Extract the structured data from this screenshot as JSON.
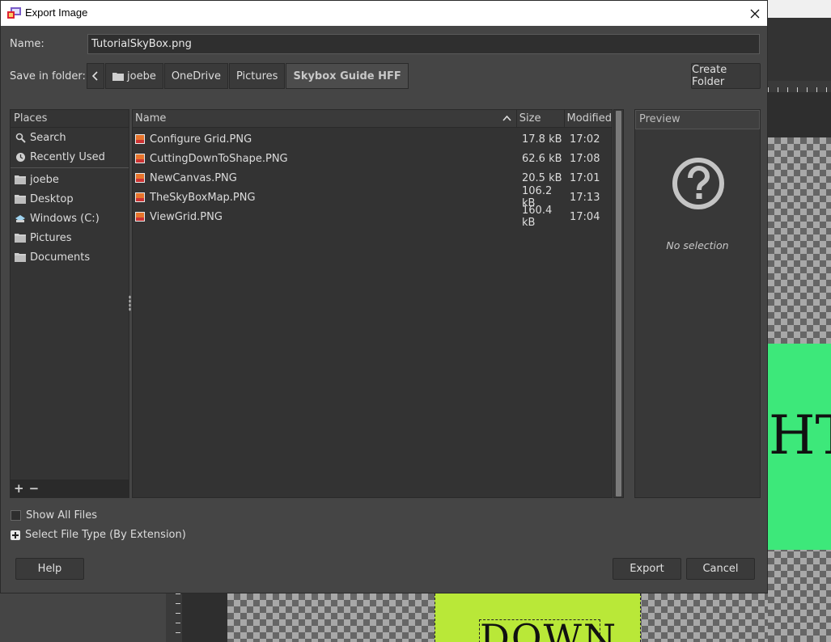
{
  "window": {
    "title": "Export Image"
  },
  "form": {
    "name_label": "Name:",
    "name_value": "TutorialSkyBox.png",
    "folder_label": "Save in folder:"
  },
  "breadcrumbs": [
    "joebe",
    "OneDrive",
    "Pictures",
    "Skybox Guide HFF"
  ],
  "create_folder": "Create Folder",
  "places": {
    "header": "Places",
    "items_top": [
      {
        "label": "Search",
        "icon": "search-icon"
      },
      {
        "label": "Recently Used",
        "icon": "clock-icon"
      }
    ],
    "items_bottom": [
      {
        "label": "joebe",
        "icon": "folder-icon"
      },
      {
        "label": "Desktop",
        "icon": "folder-icon"
      },
      {
        "label": "Windows (C:)",
        "icon": "drive-icon"
      },
      {
        "label": "Pictures",
        "icon": "folder-icon"
      },
      {
        "label": "Documents",
        "icon": "folder-icon"
      }
    ],
    "add": "+",
    "remove": "−"
  },
  "files": {
    "columns": {
      "name": "Name",
      "size": "Size",
      "modified": "Modified"
    },
    "rows": [
      {
        "name": "Configure Grid.PNG",
        "size": "17.8 kB",
        "modified": "17:02"
      },
      {
        "name": "CuttingDownToShape.PNG",
        "size": "62.6 kB",
        "modified": "17:08"
      },
      {
        "name": "NewCanvas.PNG",
        "size": "20.5 kB",
        "modified": "17:01"
      },
      {
        "name": "TheSkyBoxMap.PNG",
        "size": "106.2 kB",
        "modified": "17:13"
      },
      {
        "name": "ViewGrid.PNG",
        "size": "160.4 kB",
        "modified": "17:04"
      }
    ]
  },
  "preview": {
    "header": "Preview",
    "empty": "No selection"
  },
  "options": {
    "show_all_files": "Show All Files",
    "select_file_type": "Select File Type (By Extension)"
  },
  "buttons": {
    "help": "Help",
    "export": "Export",
    "cancel": "Cancel"
  },
  "background": {
    "canvas_right_text": "HT",
    "canvas_bottom_text": "DOWN"
  },
  "colors": {
    "dialog_bg": "#454545",
    "canvas_green": "#3de87a",
    "canvas_yellow": "#b9e838"
  }
}
